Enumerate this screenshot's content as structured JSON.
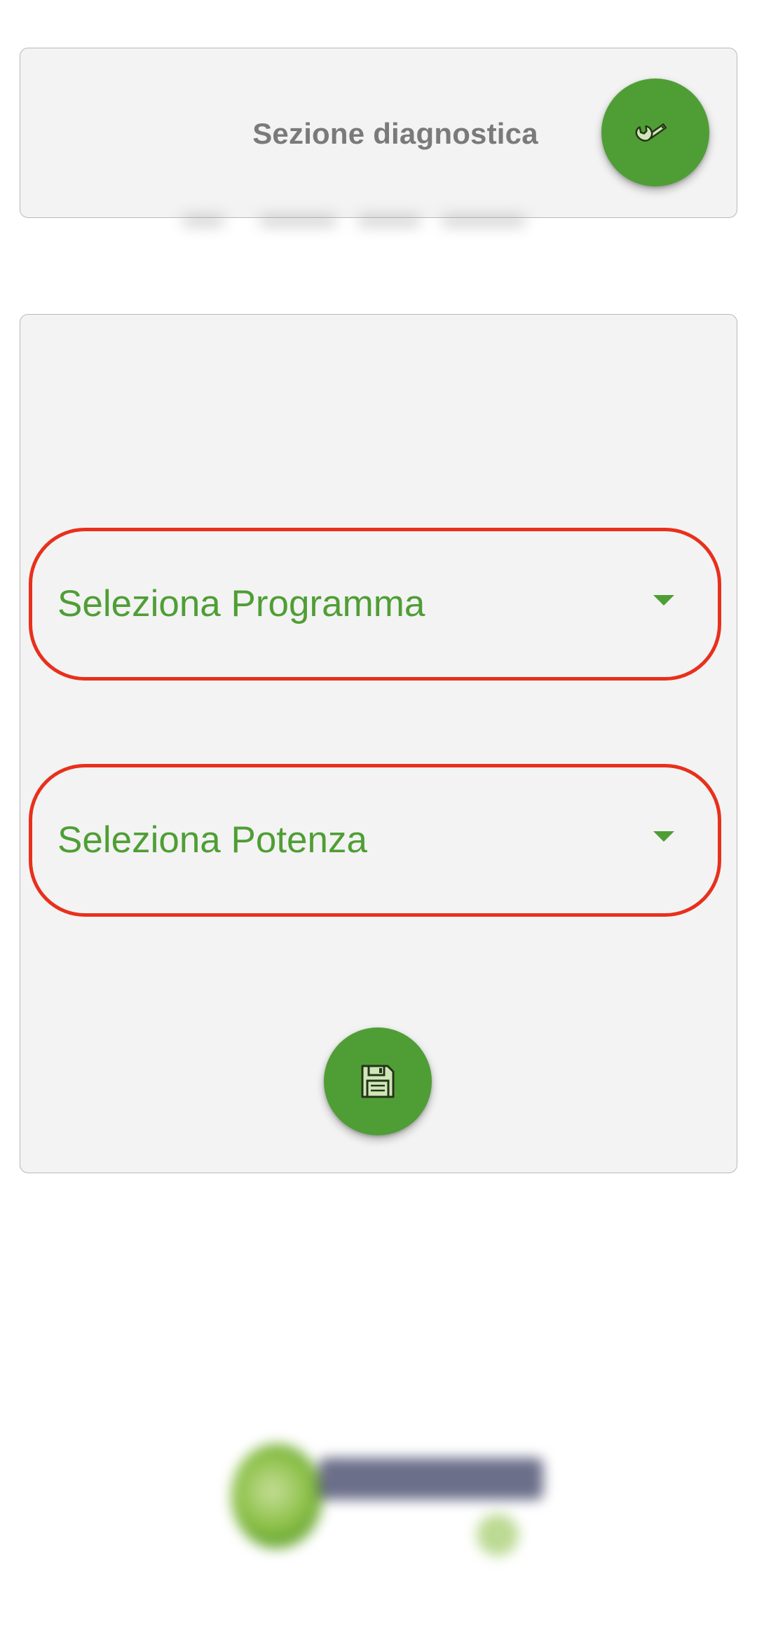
{
  "diagnostics": {
    "title": "Sezione diagnostica",
    "action_icon": "wrench-icon"
  },
  "settings": {
    "program_select": {
      "label": "Seleziona Programma",
      "icon": "dropdown-caret-icon"
    },
    "power_select": {
      "label": "Seleziona Potenza",
      "icon": "dropdown-caret-icon"
    },
    "save_icon": "floppy-disk-icon"
  },
  "colors": {
    "accent_green": "#4f9e35",
    "highlight_red": "#e8301c",
    "card_background": "#f3f3f3",
    "title_gray": "#7a7a7a"
  },
  "logo": {
    "name": "brand-logo"
  }
}
